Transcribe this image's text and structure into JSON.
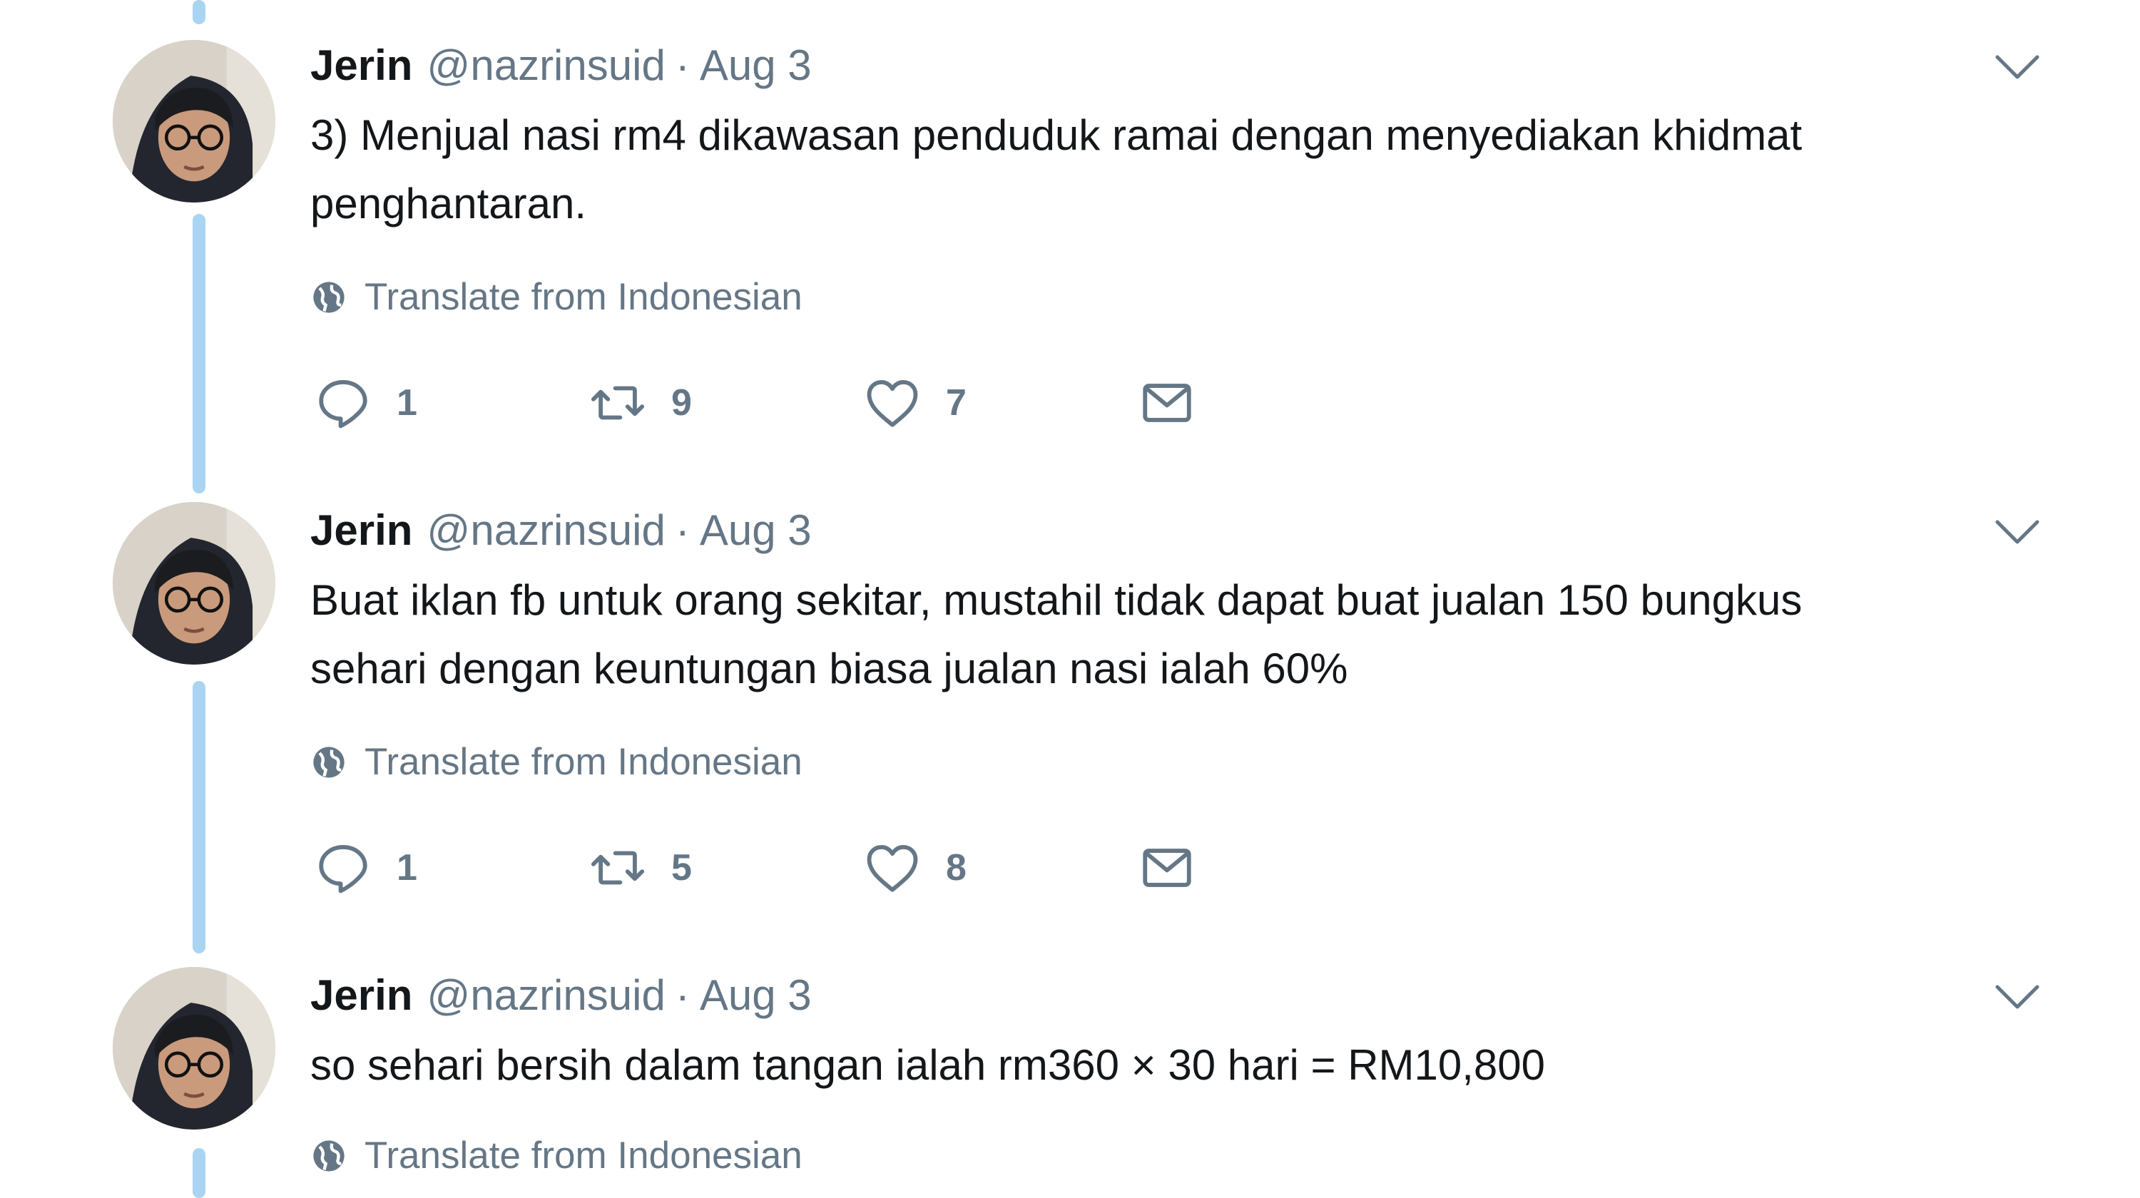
{
  "thread": {
    "tweets": [
      {
        "name": "Jerin",
        "handle": "@nazrinsuid",
        "separator": "·",
        "date": "Aug 3",
        "text_lines": [
          "3) Menjual nasi rm4 dikawasan penduduk ramai dengan menyediakan khidmat",
          "penghantaran."
        ],
        "translate_label": "Translate from Indonesian",
        "reply_count": "1",
        "retweet_count": "9",
        "like_count": "7"
      },
      {
        "name": "Jerin",
        "handle": "@nazrinsuid",
        "separator": "·",
        "date": "Aug 3",
        "text_lines": [
          "Buat iklan fb untuk orang sekitar, mustahil tidak dapat buat jualan 150 bungkus",
          "sehari dengan keuntungan biasa jualan nasi ialah 60%"
        ],
        "translate_label": "Translate from Indonesian",
        "reply_count": "1",
        "retweet_count": "5",
        "like_count": "8"
      },
      {
        "name": "Jerin",
        "handle": "@nazrinsuid",
        "separator": "·",
        "date": "Aug 3",
        "text_lines": [
          "so sehari bersih dalam tangan ialah rm360 × 30 hari = RM10,800"
        ],
        "translate_label": "Translate from Indonesian"
      }
    ]
  },
  "icons": {
    "globe": "globe-icon",
    "reply": "reply-icon",
    "retweet": "retweet-icon",
    "like": "heart-icon",
    "message": "envelope-icon",
    "menu": "chevron-down-icon"
  },
  "colors": {
    "thread_line": "#a9d5f3",
    "secondary_text": "#657786",
    "primary_text": "#14171a"
  }
}
